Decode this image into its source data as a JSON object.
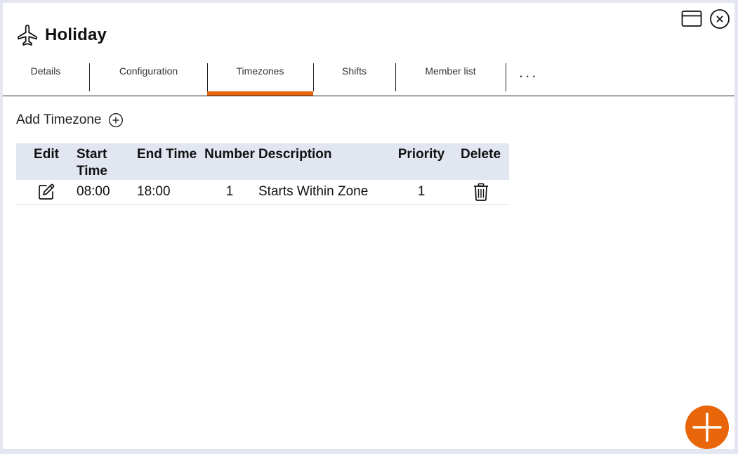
{
  "window": {
    "title": "Holiday"
  },
  "tabs": [
    {
      "label": "Details",
      "active": false
    },
    {
      "label": "Configuration",
      "active": false
    },
    {
      "label": "Timezones",
      "active": true
    },
    {
      "label": "Shifts",
      "active": false
    },
    {
      "label": "Member list",
      "active": false
    }
  ],
  "tabs_more": "...",
  "add_timezone": {
    "label": "Add Timezone"
  },
  "table": {
    "headers": {
      "edit": "Edit",
      "start_time": "Start Time",
      "end_time": "End Time",
      "number": "Number",
      "description": "Description",
      "priority": "Priority",
      "delete": "Delete"
    },
    "rows": [
      {
        "start_time": "08:00",
        "end_time": "18:00",
        "number": "1",
        "description": "Starts Within Zone",
        "priority": "1"
      }
    ]
  },
  "colors": {
    "accent": "#e8650a",
    "header_bg": "#e2e6f1",
    "page_bg": "#e4e7f2"
  },
  "icons": {
    "title": "airplane-icon",
    "window_controls": [
      "maximize-window-icon",
      "close-circle-icon"
    ],
    "add": "plus-circle-icon",
    "row_edit": "pencil-square-icon",
    "row_delete": "trash-icon",
    "fab": "plus-icon"
  }
}
